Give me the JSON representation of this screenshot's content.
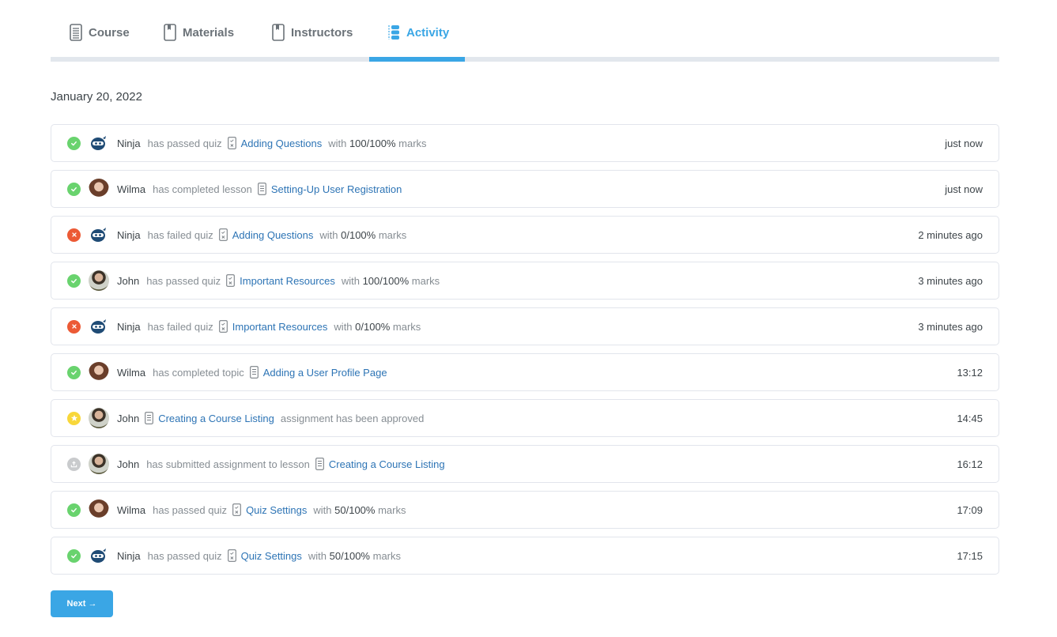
{
  "tabs": [
    {
      "label": "Course",
      "icon": "document-icon",
      "active": false
    },
    {
      "label": "Materials",
      "icon": "bookmark-book-icon",
      "active": false
    },
    {
      "label": "Instructors",
      "icon": "bookmark-book-icon",
      "active": false
    },
    {
      "label": "Activity",
      "icon": "activity-list-icon",
      "active": true
    }
  ],
  "colors": {
    "accent": "#3aa6e5",
    "link": "#2d74b5",
    "pass": "#69d36e",
    "fail": "#ec5a35",
    "approved": "#f8d73a",
    "submitted": "#c9cbcd"
  },
  "date": "January 20, 2022",
  "activities": [
    {
      "status": "pass",
      "user": "Ninja",
      "avatar": "ninja",
      "verb": "has passed quiz",
      "item_type": "quiz",
      "item": "Adding Questions",
      "suffix_pre": "with",
      "score": "100/100%",
      "suffix_post": "marks",
      "time": "just now"
    },
    {
      "status": "pass",
      "user": "Wilma",
      "avatar": "wilma",
      "verb": "has completed lesson",
      "item_type": "lesson",
      "item": "Setting-Up User Registration",
      "suffix_pre": "",
      "score": "",
      "suffix_post": "",
      "time": "just now"
    },
    {
      "status": "fail",
      "user": "Ninja",
      "avatar": "ninja",
      "verb": "has failed quiz",
      "item_type": "quiz",
      "item": "Adding Questions",
      "suffix_pre": "with",
      "score": "0/100%",
      "suffix_post": "marks",
      "time": "2 minutes ago"
    },
    {
      "status": "pass",
      "user": "John",
      "avatar": "john",
      "verb": "has passed quiz",
      "item_type": "quiz",
      "item": "Important Resources",
      "suffix_pre": "with",
      "score": "100/100%",
      "suffix_post": "marks",
      "time": "3 minutes ago"
    },
    {
      "status": "fail",
      "user": "Ninja",
      "avatar": "ninja",
      "verb": "has failed quiz",
      "item_type": "quiz",
      "item": "Important Resources",
      "suffix_pre": "with",
      "score": "0/100%",
      "suffix_post": "marks",
      "time": "3 minutes ago"
    },
    {
      "status": "pass",
      "user": "Wilma",
      "avatar": "wilma",
      "verb": "has completed topic",
      "item_type": "lesson",
      "item": "Adding a User Profile Page",
      "suffix_pre": "",
      "score": "",
      "suffix_post": "",
      "time": "13:12"
    },
    {
      "status": "star",
      "user": "John",
      "avatar": "john",
      "verb": "",
      "item_type": "lesson",
      "item": "Creating a Course Listing",
      "suffix_pre": "assignment has been approved",
      "score": "",
      "suffix_post": "",
      "time": "14:45"
    },
    {
      "status": "upload",
      "user": "John",
      "avatar": "john",
      "verb": "has submitted assignment to lesson",
      "item_type": "lesson",
      "item": "Creating a Course Listing",
      "suffix_pre": "",
      "score": "",
      "suffix_post": "",
      "time": "16:12"
    },
    {
      "status": "pass",
      "user": "Wilma",
      "avatar": "wilma",
      "verb": "has passed quiz",
      "item_type": "quiz",
      "item": "Quiz Settings",
      "suffix_pre": "with",
      "score": "50/100%",
      "suffix_post": "marks",
      "time": "17:09"
    },
    {
      "status": "pass",
      "user": "Ninja",
      "avatar": "ninja",
      "verb": "has passed quiz",
      "item_type": "quiz",
      "item": "Quiz Settings",
      "suffix_pre": "with",
      "score": "50/100%",
      "suffix_post": "marks",
      "time": "17:15"
    }
  ],
  "pagination": {
    "next_label": "Next →"
  }
}
